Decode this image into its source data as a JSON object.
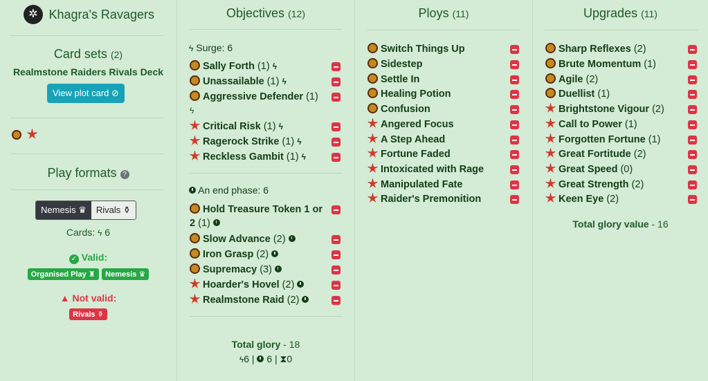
{
  "sidebar": {
    "warband_name": "Khagra's Ravagers",
    "card_sets_title": "Card sets",
    "card_sets_count": "(2)",
    "card_set_name": "Realmstone Raiders Rivals Deck",
    "view_plot_label": "View plot card",
    "play_formats_title": "Play formats",
    "toggle": {
      "nemesis": "Nemesis",
      "rivals": "Rivals"
    },
    "cards_label": "Cards:",
    "cards_value": "6",
    "valid_label": "Valid:",
    "valid_badges": [
      "Organised Play",
      "Nemesis"
    ],
    "not_valid_label": "Not valid:",
    "not_valid_badges": [
      "Rivals"
    ]
  },
  "objectives": {
    "title": "Objectives",
    "count": "(12)",
    "surge_label": "Surge: 6",
    "end_phase_label": "An end phase: 6",
    "surge_items": [
      {
        "name": "Sally Forth",
        "count": "(1)",
        "icon": "gold"
      },
      {
        "name": "Unassailable",
        "count": "(1)",
        "icon": "gold"
      },
      {
        "name": "Aggressive Defender",
        "count": "(1)",
        "icon": "gold"
      },
      {
        "name": "Critical Risk",
        "count": "(1)",
        "icon": "red"
      },
      {
        "name": "Ragerock Strike",
        "count": "(1)",
        "icon": "red"
      },
      {
        "name": "Reckless Gambit",
        "count": "(1)",
        "icon": "red"
      }
    ],
    "end_items": [
      {
        "name": "Hold Treasure Token 1 or",
        "name2": "2",
        "count": "(1)",
        "icon": "gold"
      },
      {
        "name": "Slow Advance",
        "count": "(2)",
        "icon": "gold"
      },
      {
        "name": "Iron Grasp",
        "count": "(2)",
        "icon": "gold"
      },
      {
        "name": "Supremacy",
        "count": "(3)",
        "icon": "gold"
      },
      {
        "name": "Hoarder's Hovel",
        "count": "(2)",
        "icon": "red"
      },
      {
        "name": "Realmstone Raid",
        "count": "(2)",
        "icon": "red"
      }
    ],
    "total_label": "Total glory",
    "total_value": "- 18",
    "totals": {
      "surge": "6",
      "end": "6",
      "other": "0"
    }
  },
  "ploys": {
    "title": "Ploys",
    "count": "(11)",
    "items": [
      {
        "name": "Switch Things Up",
        "icon": "gold"
      },
      {
        "name": "Sidestep",
        "icon": "gold"
      },
      {
        "name": "Settle In",
        "icon": "gold"
      },
      {
        "name": "Healing Potion",
        "icon": "gold"
      },
      {
        "name": "Confusion",
        "icon": "gold"
      },
      {
        "name": "Angered Focus",
        "icon": "red"
      },
      {
        "name": "A Step Ahead",
        "icon": "red"
      },
      {
        "name": "Fortune Faded",
        "icon": "red"
      },
      {
        "name": "Intoxicated with Rage",
        "icon": "red"
      },
      {
        "name": "Manipulated Fate",
        "icon": "red"
      },
      {
        "name": "Raider's Premonition",
        "icon": "red"
      }
    ]
  },
  "upgrades": {
    "title": "Upgrades",
    "count": "(11)",
    "items": [
      {
        "name": "Sharp Reflexes",
        "count": "(2)",
        "icon": "gold"
      },
      {
        "name": "Brute Momentum",
        "count": "(1)",
        "icon": "gold"
      },
      {
        "name": "Agile",
        "count": "(2)",
        "icon": "gold"
      },
      {
        "name": "Duellist",
        "count": "(1)",
        "icon": "gold"
      },
      {
        "name": "Brightstone Vigour",
        "count": "(2)",
        "icon": "red"
      },
      {
        "name": "Call to Power",
        "count": "(1)",
        "icon": "red"
      },
      {
        "name": "Forgotten Fortune",
        "count": "(1)",
        "icon": "red"
      },
      {
        "name": "Great Fortitude",
        "count": "(2)",
        "icon": "red"
      },
      {
        "name": "Great Speed",
        "count": "(0)",
        "icon": "red"
      },
      {
        "name": "Great Strength",
        "count": "(2)",
        "icon": "red"
      },
      {
        "name": "Keen Eye",
        "count": "(2)",
        "icon": "red"
      }
    ],
    "total_label": "Total glory value",
    "total_value": "- 16"
  },
  "colors": {
    "background": "#d4ebd6",
    "heading": "#1e5a28",
    "remove": "#dc3545",
    "valid": "#28a745",
    "plot_button": "#17a2b8"
  }
}
